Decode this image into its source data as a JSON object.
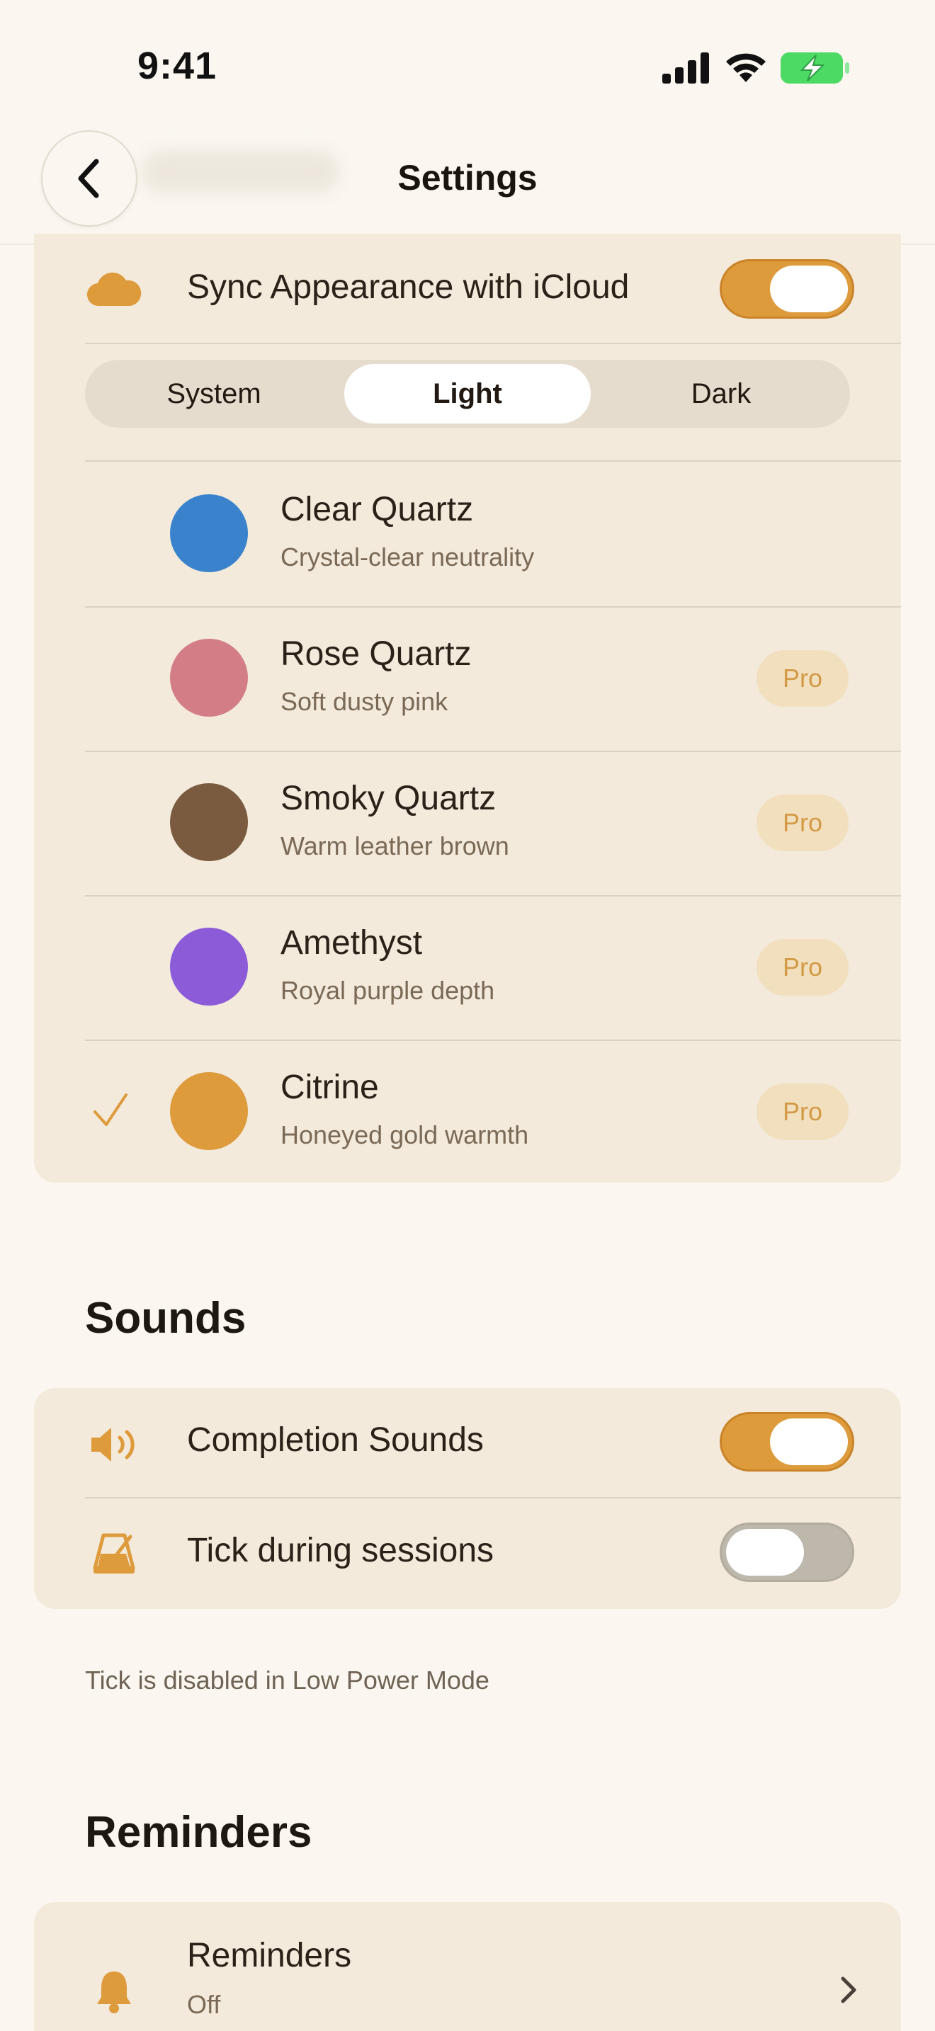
{
  "status_bar": {
    "time": "9:41"
  },
  "nav": {
    "title": "Settings"
  },
  "appearance": {
    "sync_label": "Sync Appearance with iCloud",
    "sync_on": true,
    "segments": [
      "System",
      "Light",
      "Dark"
    ],
    "selected_segment": "Light",
    "themes": [
      {
        "name": "Clear Quartz",
        "desc": "Crystal-clear neutrality",
        "color": "#3A83CC",
        "pro": "",
        "selected": false
      },
      {
        "name": "Rose Quartz",
        "desc": "Soft dusty pink",
        "color": "#D37E86",
        "pro": "Pro",
        "selected": false
      },
      {
        "name": "Smoky Quartz",
        "desc": "Warm leather brown",
        "color": "#7A5B3F",
        "pro": "Pro",
        "selected": false
      },
      {
        "name": "Amethyst",
        "desc": "Royal purple depth",
        "color": "#8B5BD8",
        "pro": "Pro",
        "selected": false
      },
      {
        "name": "Citrine",
        "desc": "Honeyed gold warmth",
        "color": "#DE9B3C",
        "pro": "Pro",
        "selected": true
      }
    ]
  },
  "sounds": {
    "title": "Sounds",
    "completion_label": "Completion Sounds",
    "completion_on": true,
    "tick_label": "Tick during sessions",
    "tick_on": false,
    "footnote": "Tick is disabled in Low Power Mode"
  },
  "reminders": {
    "title": "Reminders",
    "row_label": "Reminders",
    "row_value": "Off"
  },
  "colors": {
    "accent": "#DE9B3C",
    "background": "#FBF7F0",
    "card": "#F3EADC",
    "battery_green": "#4CD964"
  },
  "icons": [
    "signal-icon",
    "wifi-icon",
    "battery-charging-icon",
    "back-chevron-icon",
    "cloud-icon",
    "checkmark-icon",
    "speaker-icon",
    "metronome-icon",
    "bell-icon",
    "chevron-right-icon"
  ]
}
